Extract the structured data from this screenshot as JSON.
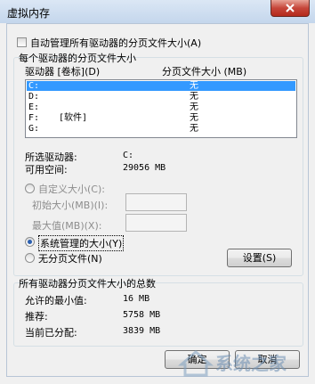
{
  "window": {
    "title": "虚拟内存"
  },
  "auto_manage": {
    "label": "自动管理所有驱动器的分页文件大小(A)",
    "checked": false
  },
  "drives_group": {
    "title": "每个驱动器的分页文件大小",
    "col_drive": "驱动器 [卷标](D)",
    "col_size": "分页文件大小 (MB)",
    "rows": [
      {
        "drive": "C:",
        "label": "",
        "size": "无"
      },
      {
        "drive": "D:",
        "label": "",
        "size": "无"
      },
      {
        "drive": "E:",
        "label": "",
        "size": "无"
      },
      {
        "drive": "F:",
        "label": "[软件]",
        "size": "无"
      },
      {
        "drive": "G:",
        "label": "",
        "size": "无"
      }
    ],
    "selected_drive_label": "所选驱动器:",
    "selected_drive_value": "C:",
    "free_space_label": "可用空间:",
    "free_space_value": "29056 MB",
    "custom_size_label": "自定义大小(C):",
    "initial_size_label": "初始大小(MB)(I):",
    "max_size_label": "最大值(MB)(X):",
    "system_managed_label": "系统管理的大小(Y)",
    "no_paging_label": "无分页文件(N)",
    "selected_option": "system_managed",
    "set_button": "设置(S)"
  },
  "totals_group": {
    "title": "所有驱动器分页文件大小的总数",
    "min_label": "允许的最小值:",
    "min_value": "16 MB",
    "recommended_label": "推荐:",
    "recommended_value": "5758 MB",
    "current_label": "当前已分配:",
    "current_value": "3839 MB"
  },
  "buttons": {
    "ok": "确定",
    "cancel": "取消"
  },
  "watermark": {
    "text": "系统之家"
  }
}
